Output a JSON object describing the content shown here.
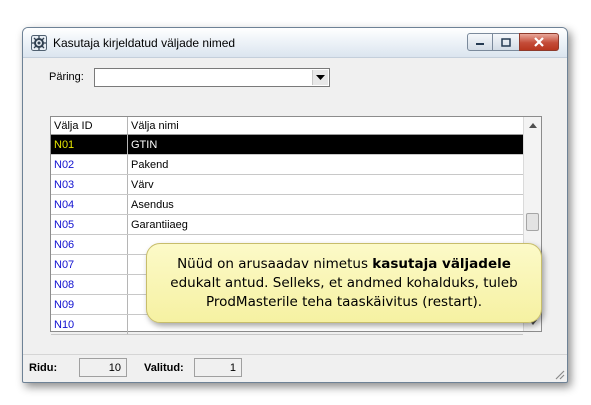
{
  "window": {
    "title": "Kasutaja kirjeldatud väljade nimed",
    "title_icon": "app-gear-icon"
  },
  "query": {
    "label": "Päring:",
    "value": ""
  },
  "grid": {
    "columns": [
      "Välja ID",
      "Välja nimi"
    ],
    "rows": [
      {
        "id": "N01",
        "name": "GTIN",
        "selected": true
      },
      {
        "id": "N02",
        "name": "Pakend"
      },
      {
        "id": "N03",
        "name": "Värv"
      },
      {
        "id": "N04",
        "name": "Asendus"
      },
      {
        "id": "N05",
        "name": "Garantiiaeg"
      },
      {
        "id": "N06",
        "name": ""
      },
      {
        "id": "N07",
        "name": ""
      },
      {
        "id": "N08",
        "name": ""
      },
      {
        "id": "N09",
        "name": ""
      },
      {
        "id": "N10",
        "name": ""
      }
    ]
  },
  "callout": {
    "line1_pre": "Nüüd on arusaadav nimetus ",
    "line1_bold": "kasutaja väljadele",
    "line2": "edukalt antud.  Selleks, et andmed kohalduks, tuleb",
    "line3": "ProdMasterile teha taaskäivitus (restart)."
  },
  "status": {
    "rows_label": "Ridu:",
    "rows_value": "10",
    "selected_label": "Valitud:",
    "selected_value": "1"
  },
  "colors": {
    "selected_row_bg": "#000000",
    "selected_id_text": "#e8e800",
    "id_text": "#1010d0",
    "callout_bg": "#f6f1a2",
    "close_button": "#c44c38"
  }
}
